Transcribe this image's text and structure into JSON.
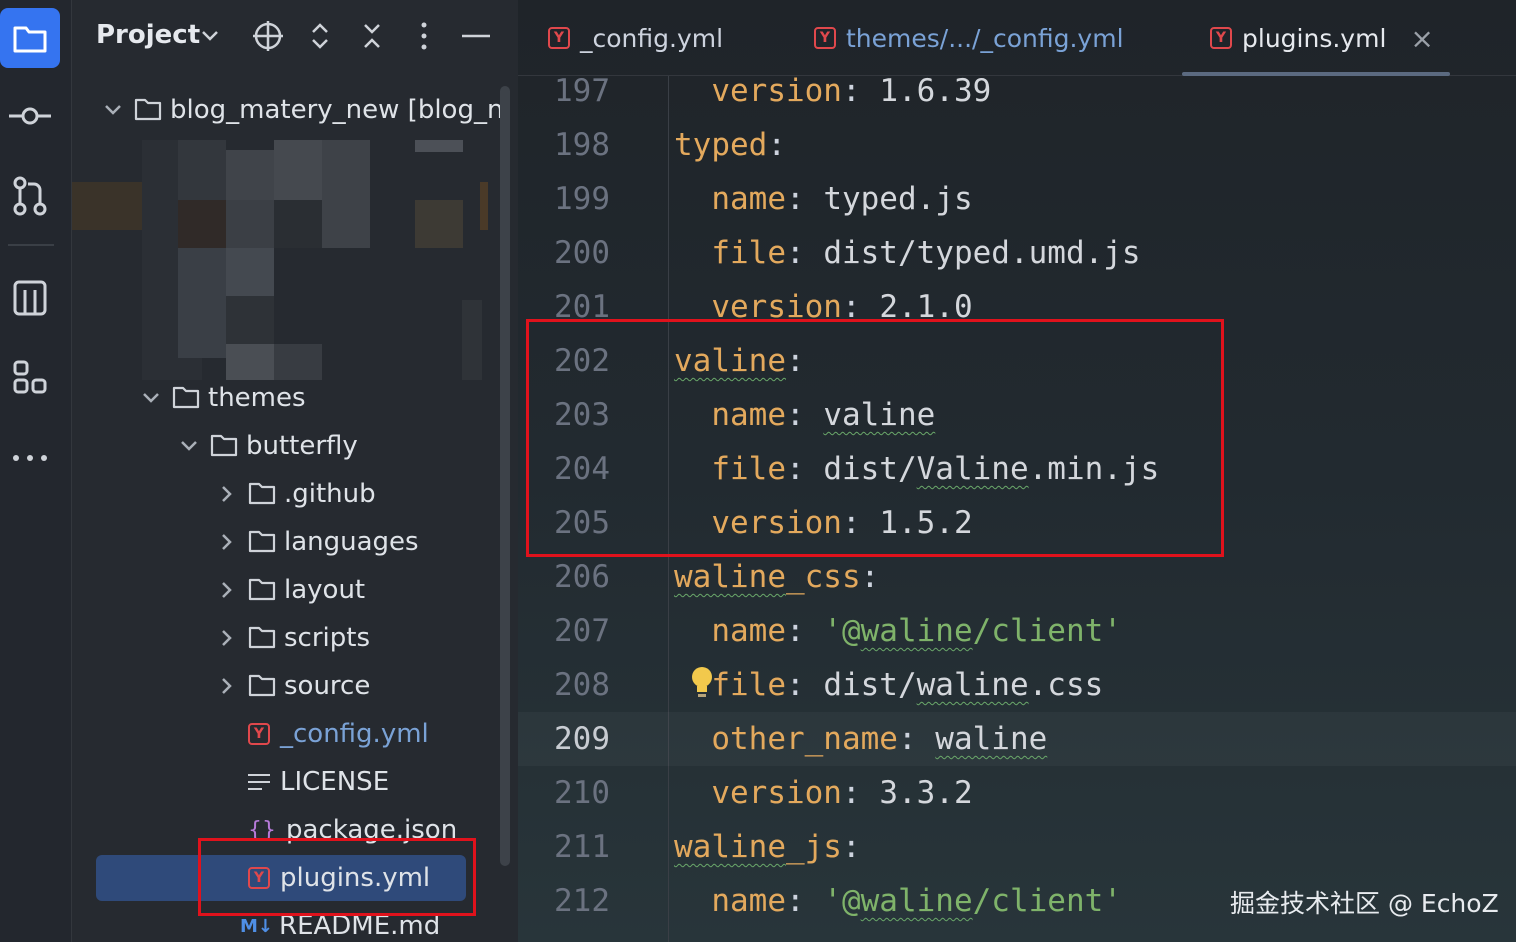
{
  "project_panel": {
    "title": "Project",
    "root": "blog_matery_new [blog_n",
    "tree": [
      {
        "label": "themes",
        "indent": 1,
        "type": "folder",
        "expanded": true
      },
      {
        "label": "butterfly",
        "indent": 2,
        "type": "folder",
        "expanded": true
      },
      {
        "label": ".github",
        "indent": 3,
        "type": "folder",
        "expanded": false
      },
      {
        "label": "languages",
        "indent": 3,
        "type": "folder",
        "expanded": false
      },
      {
        "label": "layout",
        "indent": 3,
        "type": "folder",
        "expanded": false
      },
      {
        "label": "scripts",
        "indent": 3,
        "type": "folder",
        "expanded": false
      },
      {
        "label": "source",
        "indent": 3,
        "type": "folder",
        "expanded": false
      },
      {
        "label": "_config.yml",
        "indent": 3,
        "type": "yml"
      },
      {
        "label": "LICENSE",
        "indent": 3,
        "type": "text"
      },
      {
        "label": "package.json",
        "indent": 3,
        "type": "json"
      },
      {
        "label": "plugins.yml",
        "indent": 3,
        "type": "yml",
        "selected": true
      },
      {
        "label": "README.md",
        "indent": 3,
        "type": "md"
      }
    ]
  },
  "tabs": [
    {
      "label": "_config.yml",
      "color": "#cdd3de"
    },
    {
      "label": "themes/.../_config.yml",
      "color": "#7aa2d6"
    },
    {
      "label": "plugins.yml",
      "color": "#e6e9ee",
      "active": true,
      "close": "×"
    }
  ],
  "code_lines": [
    {
      "n": "197",
      "parts": [
        [
          "  version",
          "k"
        ],
        [
          ": ",
          "p"
        ],
        [
          "1.6.39",
          "v"
        ]
      ]
    },
    {
      "n": "198",
      "parts": [
        [
          "typed",
          "k"
        ],
        [
          ":",
          "p"
        ]
      ]
    },
    {
      "n": "199",
      "parts": [
        [
          "  name",
          "k"
        ],
        [
          ": ",
          "p"
        ],
        [
          "typed.js",
          "v"
        ]
      ]
    },
    {
      "n": "200",
      "parts": [
        [
          "  file",
          "k"
        ],
        [
          ": ",
          "p"
        ],
        [
          "dist/typed.umd.js",
          "v"
        ]
      ]
    },
    {
      "n": "201",
      "parts": [
        [
          "  version",
          "k"
        ],
        [
          ": ",
          "p"
        ],
        [
          "2.1.0",
          "v"
        ]
      ]
    },
    {
      "n": "202",
      "parts": [
        [
          "valine",
          "k sq"
        ],
        [
          ":",
          "p"
        ]
      ]
    },
    {
      "n": "203",
      "parts": [
        [
          "  name",
          "k"
        ],
        [
          ": ",
          "p"
        ],
        [
          "valine",
          "v sq"
        ]
      ]
    },
    {
      "n": "204",
      "parts": [
        [
          "  file",
          "k"
        ],
        [
          ": ",
          "p"
        ],
        [
          "dist/",
          "v"
        ],
        [
          "Valine",
          "v sq"
        ],
        [
          ".min.js",
          "v"
        ]
      ]
    },
    {
      "n": "205",
      "parts": [
        [
          "  version",
          "k"
        ],
        [
          ": ",
          "p"
        ],
        [
          "1.5.2",
          "v"
        ]
      ]
    },
    {
      "n": "206",
      "parts": [
        [
          "waline",
          "k sq"
        ],
        [
          "_css",
          "k"
        ],
        [
          ":",
          "p"
        ]
      ]
    },
    {
      "n": "207",
      "parts": [
        [
          "  name",
          "k"
        ],
        [
          ": ",
          "p"
        ],
        [
          "'@",
          "s"
        ],
        [
          "waline",
          "s sq"
        ],
        [
          "/client'",
          "s"
        ]
      ]
    },
    {
      "n": "208",
      "parts": [
        [
          "  file",
          "k"
        ],
        [
          ": ",
          "p"
        ],
        [
          "dist/",
          "v"
        ],
        [
          "waline",
          "v sq"
        ],
        [
          ".css",
          "v"
        ]
      ]
    },
    {
      "n": "209",
      "parts": [
        [
          "  other_name",
          "k"
        ],
        [
          ": ",
          "p"
        ],
        [
          "waline",
          "v sq"
        ]
      ],
      "current": true
    },
    {
      "n": "210",
      "parts": [
        [
          "  version",
          "k"
        ],
        [
          ": ",
          "p"
        ],
        [
          "3.3.2",
          "v"
        ]
      ]
    },
    {
      "n": "211",
      "parts": [
        [
          "waline",
          "k sq"
        ],
        [
          "_js",
          "k"
        ],
        [
          ":",
          "p"
        ]
      ]
    },
    {
      "n": "212",
      "parts": [
        [
          "  name",
          "k"
        ],
        [
          ": ",
          "p"
        ],
        [
          "'@",
          "s"
        ],
        [
          "waline",
          "s sq"
        ],
        [
          "/client'",
          "s"
        ]
      ]
    }
  ],
  "watermark": "掘金技术社区 @ EchoZ",
  "colors": {
    "accent": "#3574f0",
    "highlight_box": "#e0121c",
    "keyword": "#e3a95d",
    "string": "#7fb36a"
  }
}
